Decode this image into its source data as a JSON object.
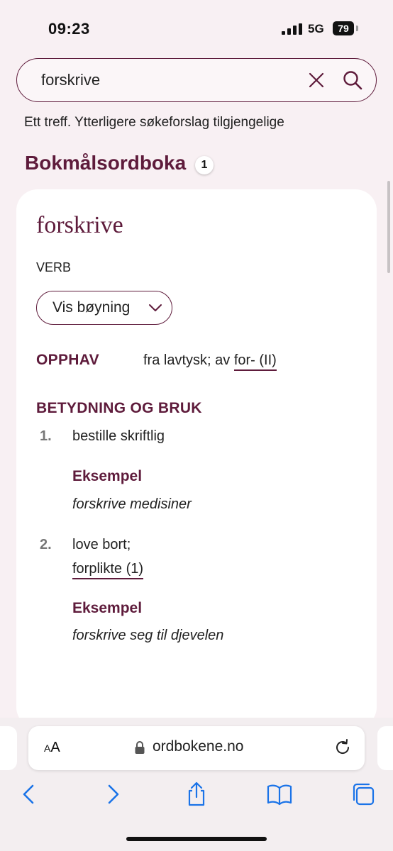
{
  "status_bar": {
    "time": "09:23",
    "network": "5G",
    "battery": "79"
  },
  "search": {
    "value": "forskrive",
    "placeholder": ""
  },
  "result_info": "Ett treff. Ytterligere søkeforslag tilgjengelige",
  "dictionary": {
    "title": "Bokmålsordboka",
    "count": "1"
  },
  "entry": {
    "headword": "forskrive",
    "pos": "VERB",
    "inflection_button": "Vis bøyning",
    "origin_label": "OPPHAV",
    "origin_text": "fra lavtysk; av ",
    "origin_link": "for- (II)",
    "meaning_label": "BETYDNING OG BRUK",
    "definitions": [
      {
        "num": "1.",
        "text": "bestille skriftlig",
        "example_label": "Eksempel",
        "example": "forskrive medisiner"
      },
      {
        "num": "2.",
        "text": "love bort;",
        "link": "forplikte (1)",
        "example_label": "Eksempel",
        "example": "forskrive seg til djevelen"
      }
    ]
  },
  "browser": {
    "aa_label_small": "A",
    "aa_label_large": "A",
    "url": "ordbokene.no"
  },
  "colors": {
    "accent": "#5e1b3b",
    "background": "#f8f0f3",
    "link_blue": "#1a73e8"
  }
}
